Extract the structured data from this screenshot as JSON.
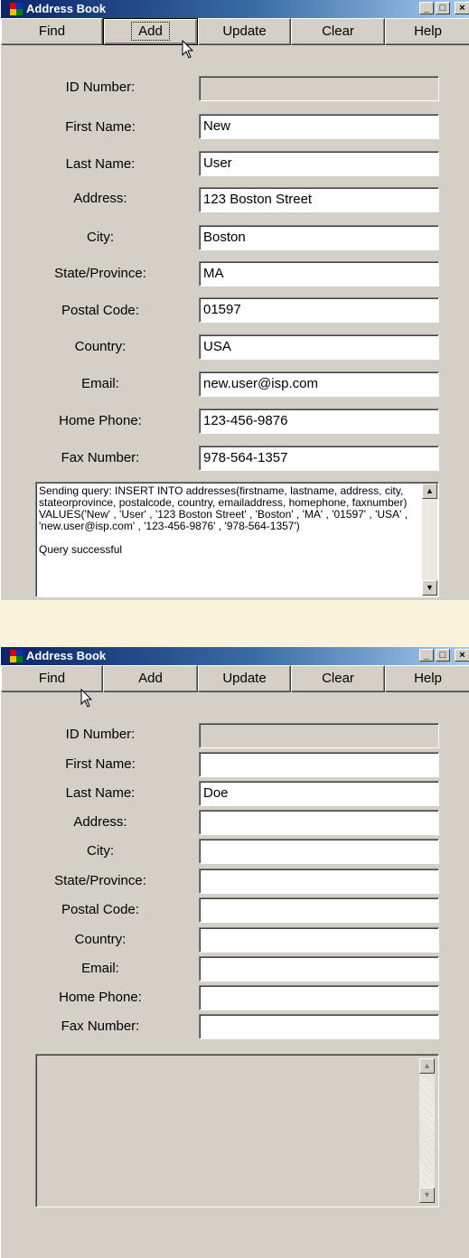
{
  "windows": [
    {
      "title": "Address Book",
      "caption_buttons": {
        "minimize": "_",
        "maximize": "□",
        "close": "×"
      },
      "menu": {
        "find": "Find",
        "add": "Add",
        "update": "Update",
        "clear": "Clear",
        "help": "Help"
      },
      "labels": {
        "id": "ID Number:",
        "first": "First Name:",
        "last": "Last Name:",
        "address": "Address:",
        "city": "City:",
        "state": "State/Province:",
        "postal": "Postal Code:",
        "country": "Country:",
        "email": "Email:",
        "home": "Home Phone:",
        "fax": "Fax Number:"
      },
      "values": {
        "id": "",
        "first": "New",
        "last": "User",
        "address": "123 Boston Street",
        "city": "Boston",
        "state": "MA",
        "postal": "01597",
        "country": "USA",
        "email": "new.user@isp.com",
        "home": "123-456-9876",
        "fax": "978-564-1357"
      },
      "log": "Sending query: INSERT INTO addresses(firstname, lastname, address, city, stateorprovince, postalcode, country, emailaddress, homephone, faxnumber) VALUES('New' , 'User' , '123 Boston Street' , 'Boston' , 'MA' , '01597' , 'USA' , 'new.user@isp.com' , '123-456-9876' , '978-564-1357')\n\nQuery successful",
      "scroll_up": "▲",
      "scroll_down": "▼"
    },
    {
      "title": "Address Book",
      "caption_buttons": {
        "minimize": "_",
        "maximize": "□",
        "close": "×"
      },
      "menu": {
        "find": "Find",
        "add": "Add",
        "update": "Update",
        "clear": "Clear",
        "help": "Help"
      },
      "labels": {
        "id": "ID Number:",
        "first": "First Name:",
        "last": "Last Name:",
        "address": "Address:",
        "city": "City:",
        "state": "State/Province:",
        "postal": "Postal Code:",
        "country": "Country:",
        "email": "Email:",
        "home": "Home Phone:",
        "fax": "Fax Number:"
      },
      "values": {
        "id": "",
        "first": "",
        "last": "Doe",
        "address": "",
        "city": "",
        "state": "",
        "postal": "",
        "country": "",
        "email": "",
        "home": "",
        "fax": ""
      },
      "log": "",
      "scroll_up": "▲",
      "scroll_down": "▼"
    }
  ]
}
